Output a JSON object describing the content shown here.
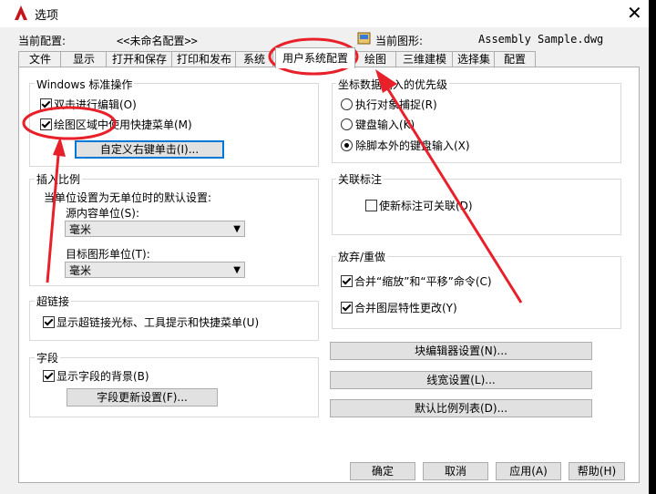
{
  "window": {
    "title": "选项",
    "close_glyph": "✕"
  },
  "header": {
    "profile_label": "当前配置:",
    "profile_value": "<<未命名配置>>",
    "drawing_label": "当前图形:",
    "drawing_value": "Assembly Sample.dwg"
  },
  "tabs": [
    "文件",
    "显示",
    "打开和保存",
    "打印和发布",
    "系统",
    "用户系统配置",
    "绘图",
    "三维建模",
    "选择集",
    "配置"
  ],
  "active_tab": "用户系统配置",
  "windows_ops": {
    "title": "Windows 标准操作",
    "dblclick": "双击进行编辑(O)",
    "shortcut_menu": "绘图区域中使用快捷菜单(M)",
    "custom_right_click": "自定义右键单击(I)..."
  },
  "insert_scale": {
    "title": "插入比例",
    "desc": "当单位设置为无单位时的默认设置:",
    "source_label": "源内容单位(S):",
    "source_value": "毫米",
    "target_label": "目标图形单位(T):",
    "target_value": "毫米"
  },
  "hyperlink": {
    "title": "超链接",
    "option": "显示超链接光标、工具提示和快捷菜单(U)"
  },
  "fields": {
    "title": "字段",
    "option": "显示字段的背景(B)",
    "button": "字段更新设置(F)..."
  },
  "coord_priority": {
    "title": "坐标数据输入的优先级",
    "opt1": "执行对象捕捉(R)",
    "opt2": "键盘输入(K)",
    "opt3": "除脚本外的键盘输入(X)"
  },
  "assoc_dim": {
    "title": "关联标注",
    "option": "使新标注可关联(D)"
  },
  "undo_redo": {
    "title": "放弃/重做",
    "opt1": "合并“缩放”和“平移”命令(C)",
    "opt2": "合并图层特性更改(Y)"
  },
  "right_buttons": {
    "block_editor": "块编辑器设置(N)...",
    "lineweight": "线宽设置(L)...",
    "scale_list": "默认比例列表(D)..."
  },
  "footer": {
    "ok": "确定",
    "cancel": "取消",
    "apply": "应用(A)",
    "help": "帮助(H)"
  },
  "colors": {
    "annotation": "#e8202a",
    "focus": "#0078d7"
  }
}
